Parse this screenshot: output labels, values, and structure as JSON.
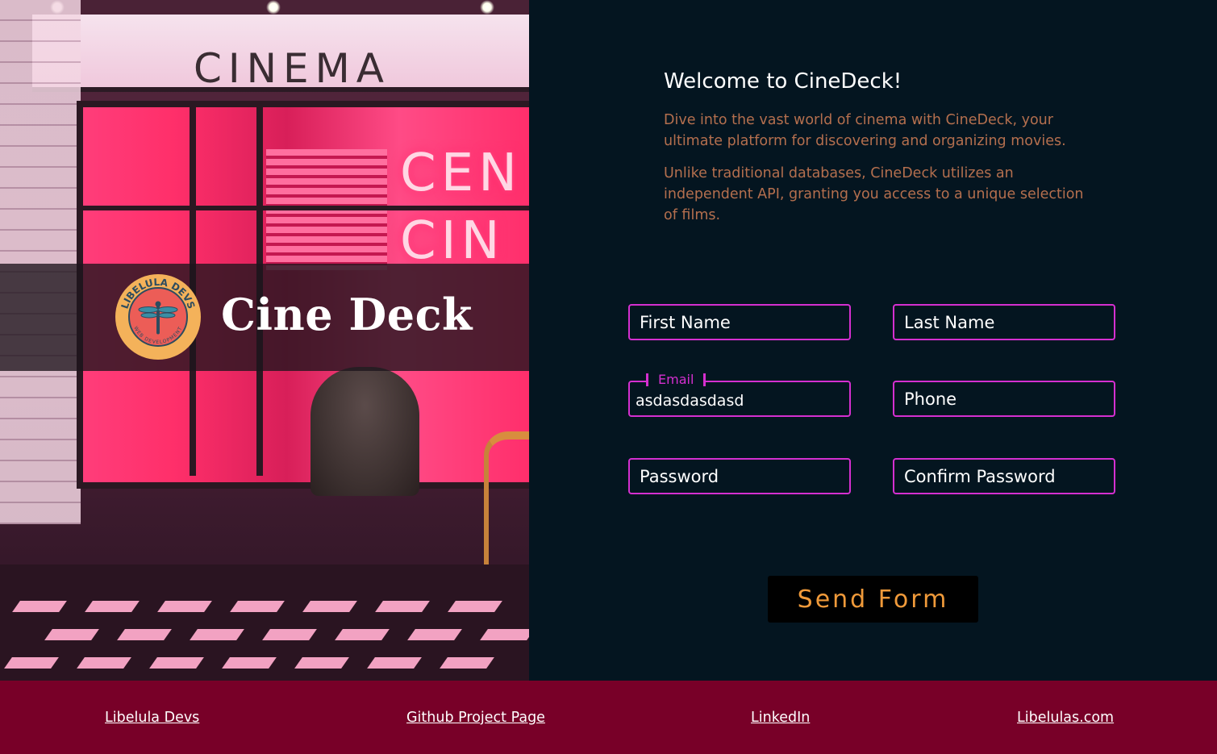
{
  "brand": {
    "title": "Cine Deck",
    "logo_text": "LIBELULA DEVS",
    "logo_subtext": "WEB DEVELOPMENT",
    "logo_icon": "dragonfly-icon"
  },
  "hero": {
    "marquee": "CINEMA",
    "neon_line1": "CEN",
    "neon_line2": "CIN"
  },
  "welcome": {
    "title": "Welcome to CineDeck!",
    "paragraph1": "Dive into the vast world of cinema with CineDeck, your ultimate platform for discovering and organizing movies.",
    "paragraph2": "Unlike traditional databases, CineDeck utilizes an independent API, granting you access to a unique selection of films."
  },
  "form": {
    "first_name": {
      "placeholder": "First Name",
      "value": ""
    },
    "last_name": {
      "placeholder": "Last Name",
      "value": ""
    },
    "email": {
      "label": "Email",
      "value": "asdasdasdasd"
    },
    "phone": {
      "placeholder": "Phone",
      "value": ""
    },
    "password": {
      "placeholder": "Password",
      "value": ""
    },
    "confirm_password": {
      "placeholder": "Confirm Password",
      "value": ""
    },
    "submit_label": "Send Form"
  },
  "footer": {
    "links": [
      "Libelula Devs",
      "Github Project Page",
      "LinkedIn",
      "Libelulas.com"
    ]
  },
  "colors": {
    "background": "#041520",
    "accent_border": "#d52fd0",
    "paragraph": "#b46f4e",
    "button_text": "#f09a3a",
    "footer": "#780028"
  }
}
